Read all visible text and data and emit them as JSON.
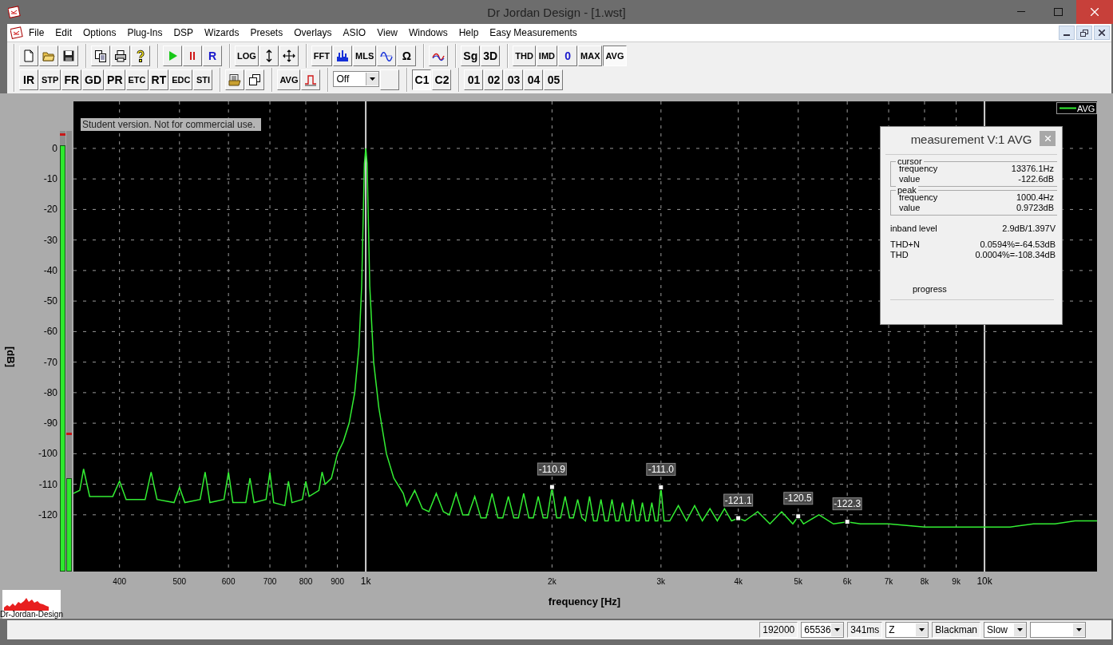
{
  "window": {
    "title": "Dr Jordan Design - [1.wst]"
  },
  "menu": [
    "File",
    "Edit",
    "Options",
    "Plug-Ins",
    "DSP",
    "Wizards",
    "Presets",
    "Overlays",
    "ASIO",
    "View",
    "Windows",
    "Help",
    "Easy Measurements"
  ],
  "toolbars": [
    [
      [
        {
          "kind": "icon"
        },
        {
          "kind": "icon"
        },
        {
          "kind": "icon"
        }
      ],
      [
        {
          "kind": "icon"
        },
        {
          "kind": "icon"
        },
        {
          "kind": "icon"
        }
      ],
      [
        {
          "kind": "icon"
        },
        {
          "kind": "icon"
        },
        {
          "kind": "text",
          "label": "R",
          "color": "#1a1acc"
        }
      ],
      [
        {
          "kind": "text",
          "label": "LOG"
        },
        {
          "kind": "icon"
        },
        {
          "kind": "icon"
        }
      ],
      [
        {
          "kind": "text",
          "label": "FFT"
        },
        {
          "kind": "icon"
        },
        {
          "kind": "text",
          "label": "MLS"
        },
        {
          "kind": "icon"
        },
        {
          "kind": "text",
          "label": "Ω"
        }
      ],
      [
        {
          "kind": "icon"
        }
      ],
      [
        {
          "kind": "text",
          "label": "Sg"
        },
        {
          "kind": "text",
          "label": "3D"
        }
      ],
      [
        {
          "kind": "text",
          "label": "THD",
          "selected": false
        },
        {
          "kind": "text",
          "label": "IMD",
          "selected": false
        },
        {
          "kind": "text",
          "label": "0",
          "color": "#1a1acc",
          "selected": false
        },
        {
          "kind": "text",
          "label": "MAX",
          "selected": false
        },
        {
          "kind": "text",
          "label": "AVG",
          "selected": true
        }
      ]
    ],
    [
      [
        {
          "kind": "text",
          "label": "IR"
        },
        {
          "kind": "text",
          "label": "STP"
        },
        {
          "kind": "text",
          "label": "FR"
        },
        {
          "kind": "text",
          "label": "GD"
        },
        {
          "kind": "text",
          "label": "PR"
        },
        {
          "kind": "text",
          "label": "ETC"
        },
        {
          "kind": "text",
          "label": "RT"
        },
        {
          "kind": "text",
          "label": "EDC"
        },
        {
          "kind": "text",
          "label": "STI"
        }
      ],
      [
        {
          "kind": "icon"
        },
        {
          "kind": "icon"
        }
      ],
      [
        {
          "kind": "text",
          "label": "AVG"
        },
        {
          "kind": "icon"
        }
      ],
      [
        {
          "kind": "dropdown",
          "value": "Off"
        },
        {
          "kind": "blank"
        }
      ],
      [
        {
          "kind": "text",
          "label": "C1",
          "selected": true
        },
        {
          "kind": "text",
          "label": "C2",
          "selected": false
        }
      ],
      [
        {
          "kind": "text",
          "label": "01"
        },
        {
          "kind": "text",
          "label": "02"
        },
        {
          "kind": "text",
          "label": "03"
        },
        {
          "kind": "text",
          "label": "04"
        },
        {
          "kind": "text",
          "label": "05"
        }
      ]
    ]
  ],
  "plot": {
    "notice": "Student version. Not for commercial use.",
    "legend": "AVG",
    "meters": [
      {
        "level": 0.967,
        "peak": {
          "level": 0.99
        }
      },
      {
        "level": 0.212,
        "peak": {
          "level": 0.31
        }
      }
    ],
    "y_axis": {
      "title": "[dB]",
      "ticks": [
        "0",
        "-10",
        "-20",
        "-30",
        "-40",
        "-50",
        "-60",
        "-70",
        "-80",
        "-90",
        "-100",
        "-110",
        "-120"
      ]
    },
    "x_axis": {
      "title": "frequency [Hz]",
      "ticks": [
        "400",
        "500",
        "600",
        "700",
        "800",
        "900",
        "1k",
        "2k",
        "3k",
        "4k",
        "5k",
        "6k",
        "7k",
        "8k",
        "9k",
        "10k"
      ]
    },
    "markers": [
      "-110.9",
      "-111.0",
      "-121.1",
      "-120.5",
      "-122.3"
    ]
  },
  "logo": {
    "text": "Dr-Jordan-Design"
  },
  "measurement": {
    "title": "measurement V:1 AVG",
    "groups": [
      {
        "title": "cursor",
        "rows": [
          {
            "label": "frequency",
            "value": "13376.1Hz"
          },
          {
            "label": "value",
            "value": "-122.6dB"
          }
        ]
      },
      {
        "title": "peak",
        "rows": [
          {
            "label": "frequency",
            "value": "1000.4Hz"
          },
          {
            "label": "value",
            "value": "0.9723dB"
          }
        ]
      }
    ],
    "rows": [
      {
        "label": "inband level",
        "value": "2.9dB/1.397V"
      },
      {
        "label": "THD+N",
        "value": "0.0594%=-64.53dB"
      },
      {
        "label": "THD",
        "value": "0.0004%=-108.34dB"
      }
    ],
    "progress_label": "progress"
  },
  "status_bar": [
    {
      "kind": "box",
      "value": "192000"
    },
    {
      "kind": "dropdown",
      "value": "65536"
    },
    {
      "kind": "box",
      "value": "341ms"
    },
    {
      "kind": "dropdown",
      "value": "Z"
    },
    {
      "kind": "box",
      "value": "Blackman"
    },
    {
      "kind": "dropdown",
      "value": "Slow"
    },
    {
      "kind": "dropdown"
    }
  ]
}
